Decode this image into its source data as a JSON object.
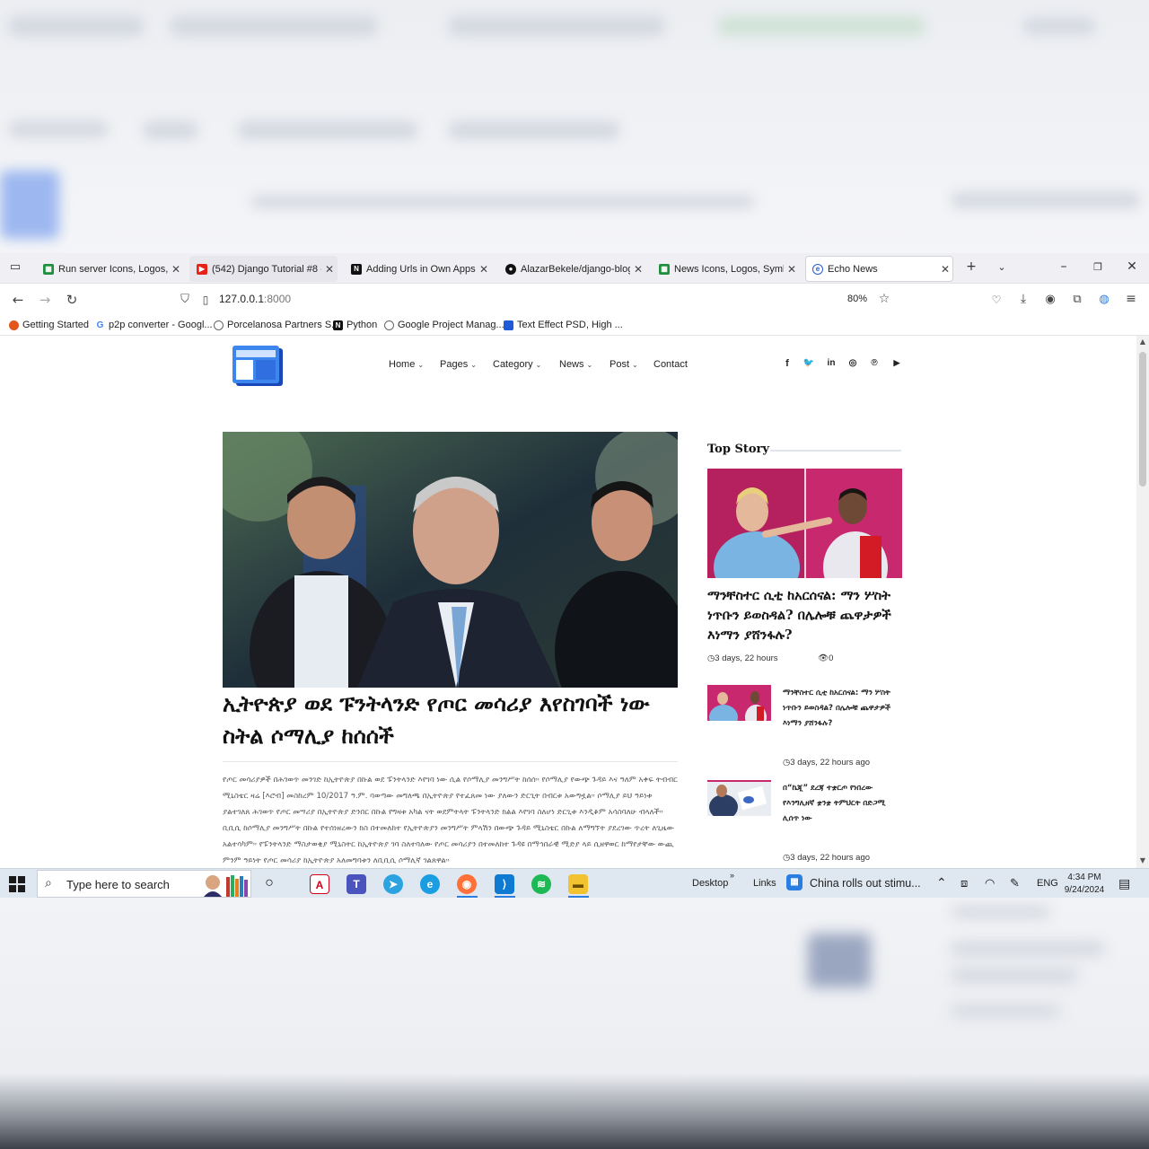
{
  "tabs": [
    {
      "label": "Run server Icons, Logos, Sym",
      "icon": "green-grid-favicon",
      "color": "#1e8e3e"
    },
    {
      "label": "(542) Django Tutorial #8 -",
      "icon": "youtube-favicon",
      "color": "#e62117"
    },
    {
      "label": "Adding Urls in Own Apps",
      "icon": "notion-favicon",
      "color": "#111111"
    },
    {
      "label": "AlazarBekele/django-blog",
      "icon": "github-favicon",
      "color": "#111111"
    },
    {
      "label": "News Icons, Logos, Symbols",
      "icon": "green-grid-favicon",
      "color": "#1e8e3e"
    },
    {
      "label": "Echo News",
      "icon": "globe-favicon",
      "color": "#2a5bd7"
    }
  ],
  "address": {
    "host": "127.0.0.1",
    "port": ":8000",
    "zoom": "80%"
  },
  "bookmarks": [
    "Getting Started",
    "p2p converter - Googl...",
    "Porcelanosa Partners S...",
    "Python",
    "Google Project Manag...",
    "Text Effect PSD, High ..."
  ],
  "site": {
    "menu": [
      "Home",
      "Pages",
      "Category",
      "News",
      "Post",
      "Contact"
    ],
    "social": [
      "f",
      "t",
      "in",
      "ig",
      "p",
      "yt"
    ]
  },
  "main_article": {
    "headline": "ኢትዮጵያ ወደ ፑንትላንድ የጦር መሳሪያ እየስገባች ነው ስትል ሶማሊያ ከሰሰች",
    "body": "የጦር መሳሪያዎች በሕገወጥ መንገድ ከኢትዮጵያ በኩል ወደ ፑንትላንድ እየገባ ነው ሲል የሶማሊያ መንግሥት ከሰሰ። የሶማሊያ የውጭ ጉዳይ እና ዓለም አቀፍ ትብብር ሚኒስቴር ዛሬ [እሮብ] መስከረም 10/2017 ዓ.ም. ባወጣው መግለጫ በኢትዮጵያ የተፈጸመ ነው ያለውን ድርጊት በብርቱ አውግዟል። ሶማሊያ ይህ ዓይነቱ ያልተገለጸ ሕገወጥ የጦር መሣሪያ በኢትዮጵያ ድንበር በኩል የግዛቱ አካል ናት ወደምትላት ፑንትላንድ ክልል እየገባ ስለሆነ ድርጊቱ እንዲቆም አሳስባለሁ ብላለች። ቢቢሲ ከሶማሊያ መንግሥት በኩል የተሰነዘረውን ክስ በተመለከተ የኢትዮጵያን መንግሥት ምላሽን በውጭ ጉዳይ ሚኒስቴር በኩል ለማግኘት ያደረገው ጥረት ለጊዜው አልተሳካም። የፑንትላንድ ማስታወቂያ ሚኒስትር ከኢትዮጵያ ገባ ስለተባለው የጦር መሳሪያን በተመለከተ ጉዳዩ በማኅበራዊ ሚድያ ላይ ሲዘዋወር ከማየታቸው ውጪ ምንም ዓይነት የጦር መሳሪያ ከኢትዮጵያ አለመግባቱን ለቢቢሲ ሶማሊኛ ገልጸዋል።"
  },
  "top_story": {
    "section_title": "Top Story",
    "headline": "ማንቸስተር ሲቲ ከአርሰናል: ማን ሦስት ነጥቡን ይወስዳል? በሌሎቹ ጨዋታዎች እነማን ያሸንፋሉ?",
    "time": "3 days, 22 hours",
    "views": "0"
  },
  "side_list": [
    {
      "headline": "ማንቸስተር ሲቲ ከአርሰናል: ማን ሦስት ነጥቡን ይወስዳል? በሌሎቹ ጨዋታዎች እነማን ያሸንፋሉ?",
      "time": "3 days, 22 hours ago"
    },
    {
      "headline": "በ“ኬጂ” ደረጃ ተቋርጦ የነበረው የእንግሊዘኛ ቋንቋ ትምህርት በድጋሚ ሊሰጥ ነው",
      "time": "3 days, 22 hours ago"
    }
  ],
  "taskbar": {
    "search_placeholder": "Type here to search",
    "desktop": "Desktop",
    "links": "Links",
    "news": "China rolls out stimu...",
    "lang": "ENG",
    "time": "4:34 PM",
    "date": "9/24/2024"
  },
  "colors": {
    "accent": "#1a73e8",
    "brand_blue": "#2f6fe0",
    "pink": "#d6246f"
  }
}
